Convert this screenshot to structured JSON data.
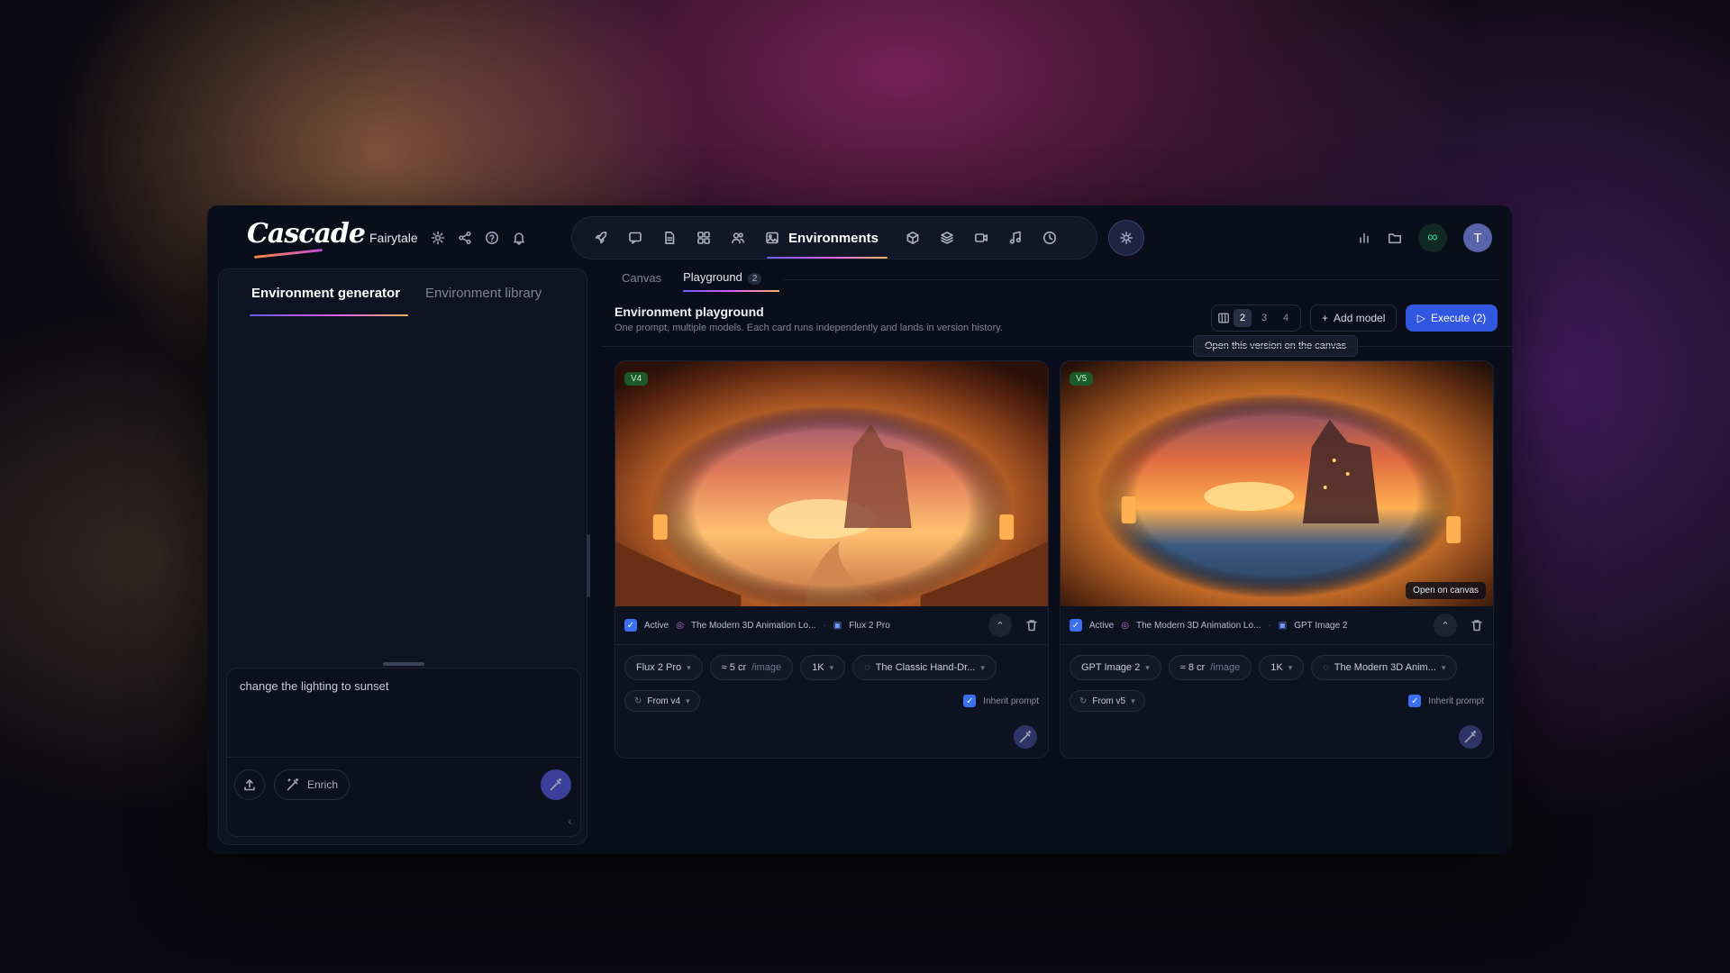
{
  "app": {
    "logo": "Cascade",
    "project_name": "Fairytale"
  },
  "nav": {
    "active_label": "Environments",
    "icons": [
      "rocket-icon",
      "chat-icon",
      "document-icon",
      "grid-icon",
      "people-icon",
      "image-icon",
      "cube-icon",
      "layers-icon",
      "video-icon",
      "music-icon",
      "clock-icon"
    ]
  },
  "header_right": {
    "infinity_symbol": "∞",
    "avatar_initial": "T"
  },
  "left_panel": {
    "tabs": [
      "Environment generator",
      "Environment library"
    ],
    "prompt_text": "change the lighting to sunset",
    "enrich_label": "Enrich"
  },
  "main": {
    "tabs": [
      "Canvas",
      "Playground"
    ],
    "playground_count": "2",
    "title": "Environment playground",
    "subtitle": "One prompt, multiple models. Each card runs independently and lands in version history.",
    "columns": [
      "2",
      "3",
      "4"
    ],
    "add_model_label": "Add model",
    "execute_label": "Execute (2)",
    "tooltip": "Open this version on the canvas"
  },
  "cards": [
    {
      "version": "V4",
      "active_label": "Active",
      "style_name": "The Modern 3D Animation Lo...",
      "model_tag": "Flux 2 Pro",
      "model_select": "Flux 2 Pro",
      "cost": "≈ 5 cr",
      "cost_unit": "/image",
      "resolution": "1K",
      "style_select": "The Classic Hand-Dr...",
      "from_version": "From v4",
      "inherit_label": "Inherit prompt",
      "open_on_canvas": ""
    },
    {
      "version": "V5",
      "active_label": "Active",
      "style_name": "The Modern 3D Animation Lo...",
      "model_tag": "GPT Image 2",
      "model_select": "GPT Image 2",
      "cost": "≈ 8 cr",
      "cost_unit": "/image",
      "resolution": "1K",
      "style_select": "The Modern 3D Anim...",
      "from_version": "From v5",
      "inherit_label": "Inherit prompt",
      "open_on_canvas": "Open on canvas"
    }
  ],
  "colors": {
    "accent": "#3157e0",
    "active_badge": "#1c5a2a",
    "panel_bg": "#0a0e1a"
  }
}
